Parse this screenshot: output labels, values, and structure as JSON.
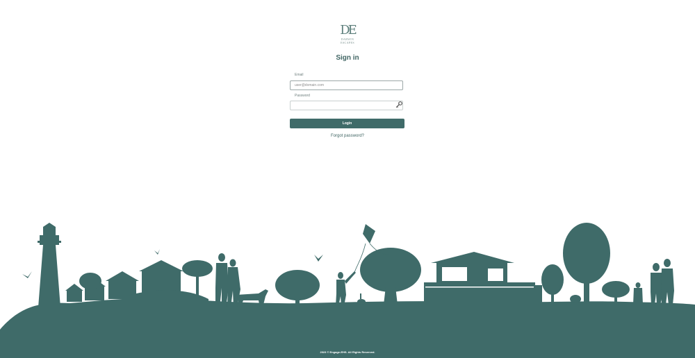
{
  "brand": {
    "mark": "DE",
    "name_line1": "DARWIN",
    "name_line2": "ESCAPES"
  },
  "form": {
    "title": "Sign in",
    "email_label": "Email",
    "email_placeholder": "user@domain.com",
    "password_label": "Password",
    "password_placeholder": "",
    "login_label": "Login",
    "forgot_label": "Forgot password?"
  },
  "icons": {
    "password_toggle": "key-icon",
    "landscape": "landscape-silhouette"
  },
  "footer": {
    "copyright": "2023 © Engage-EHS. All Rights Reserved."
  },
  "colors": {
    "accent": "#3f6b69",
    "silhouette": "#3f6b69",
    "background": "#ffffff"
  }
}
